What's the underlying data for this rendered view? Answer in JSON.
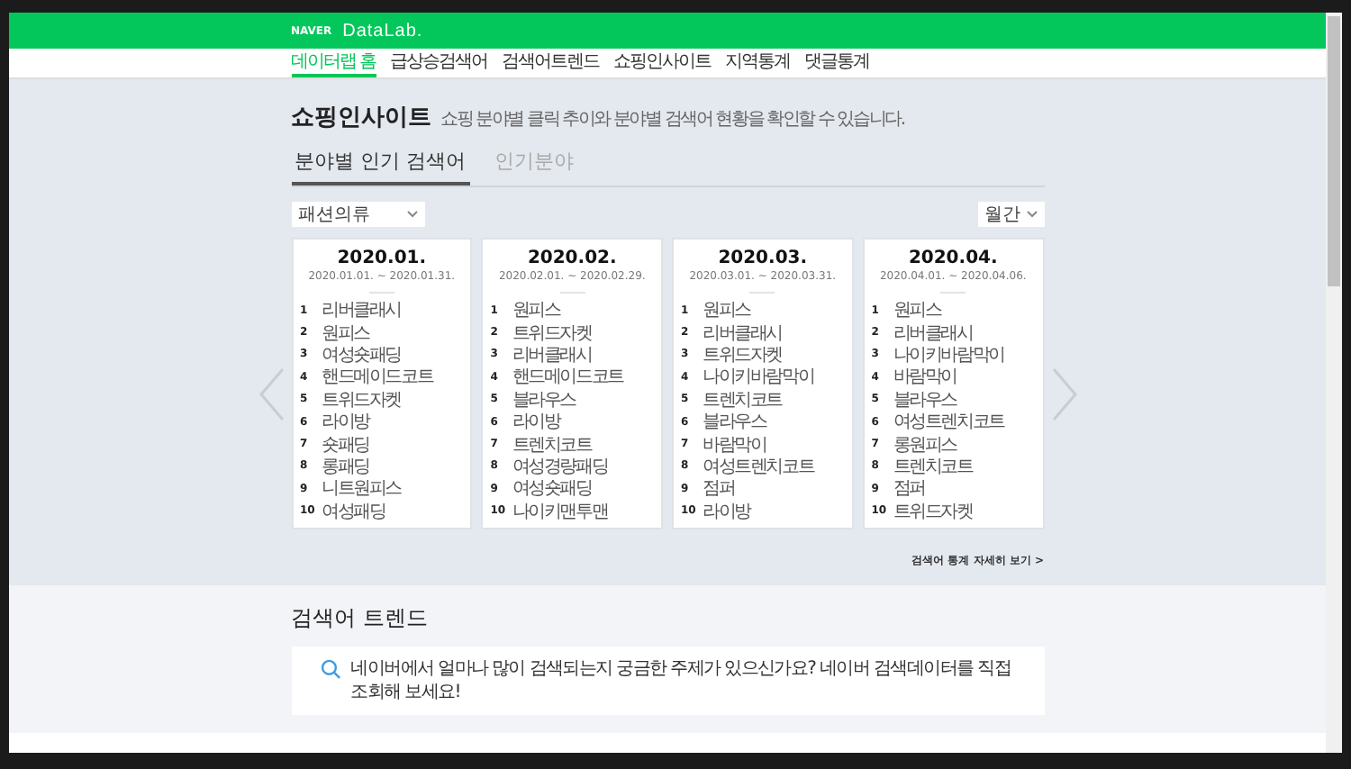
{
  "header": {
    "brand": "NAVER",
    "product": "DataLab."
  },
  "nav": [
    {
      "label": "데이터랩 홈",
      "selected": true
    },
    {
      "label": "급상승검색어",
      "selected": false
    },
    {
      "label": "검색어트렌드",
      "selected": false
    },
    {
      "label": "쇼핑인사이트",
      "selected": false
    },
    {
      "label": "지역통계",
      "selected": false
    },
    {
      "label": "댓글통계",
      "selected": false
    }
  ],
  "page": {
    "title": "쇼핑인사이트",
    "subtitle": "쇼핑 분야별 클릭 추이와 분야별 검색어 현황을 확인할 수 있습니다."
  },
  "tabs": [
    {
      "label": "분야별 인기 검색어",
      "selected": true
    },
    {
      "label": "인기분야",
      "selected": false
    }
  ],
  "category_select": {
    "value": "패션의류"
  },
  "period_select": {
    "value": "월간"
  },
  "cards": [
    {
      "month": "2020.01.",
      "range": "2020.01.01. ~ 2020.01.31.",
      "items": [
        {
          "rank": "1",
          "keyword": "리버클래시"
        },
        {
          "rank": "2",
          "keyword": "원피스"
        },
        {
          "rank": "3",
          "keyword": "여성숏패딩"
        },
        {
          "rank": "4",
          "keyword": "핸드메이드코트"
        },
        {
          "rank": "5",
          "keyword": "트위드자켓"
        },
        {
          "rank": "6",
          "keyword": "라이방"
        },
        {
          "rank": "7",
          "keyword": "숏패딩"
        },
        {
          "rank": "8",
          "keyword": "롱패딩"
        },
        {
          "rank": "9",
          "keyword": "니트원피스"
        },
        {
          "rank": "10",
          "keyword": "여성패딩"
        }
      ]
    },
    {
      "month": "2020.02.",
      "range": "2020.02.01. ~ 2020.02.29.",
      "items": [
        {
          "rank": "1",
          "keyword": "원피스"
        },
        {
          "rank": "2",
          "keyword": "트위드자켓"
        },
        {
          "rank": "3",
          "keyword": "리버클래시"
        },
        {
          "rank": "4",
          "keyword": "핸드메이드코트"
        },
        {
          "rank": "5",
          "keyword": "블라우스"
        },
        {
          "rank": "6",
          "keyword": "라이방"
        },
        {
          "rank": "7",
          "keyword": "트렌치코트"
        },
        {
          "rank": "8",
          "keyword": "여성경량패딩"
        },
        {
          "rank": "9",
          "keyword": "여성숏패딩"
        },
        {
          "rank": "10",
          "keyword": "나이키맨투맨"
        }
      ]
    },
    {
      "month": "2020.03.",
      "range": "2020.03.01. ~ 2020.03.31.",
      "items": [
        {
          "rank": "1",
          "keyword": "원피스"
        },
        {
          "rank": "2",
          "keyword": "리버클래시"
        },
        {
          "rank": "3",
          "keyword": "트위드자켓"
        },
        {
          "rank": "4",
          "keyword": "나이키바람막이"
        },
        {
          "rank": "5",
          "keyword": "트렌치코트"
        },
        {
          "rank": "6",
          "keyword": "블라우스"
        },
        {
          "rank": "7",
          "keyword": "바람막이"
        },
        {
          "rank": "8",
          "keyword": "여성트렌치코트"
        },
        {
          "rank": "9",
          "keyword": "점퍼"
        },
        {
          "rank": "10",
          "keyword": "라이방"
        }
      ]
    },
    {
      "month": "2020.04.",
      "range": "2020.04.01. ~ 2020.04.06.",
      "items": [
        {
          "rank": "1",
          "keyword": "원피스"
        },
        {
          "rank": "2",
          "keyword": "리버클래시"
        },
        {
          "rank": "3",
          "keyword": "나이키바람막이"
        },
        {
          "rank": "4",
          "keyword": "바람막이"
        },
        {
          "rank": "5",
          "keyword": "블라우스"
        },
        {
          "rank": "6",
          "keyword": "여성트렌치코트"
        },
        {
          "rank": "7",
          "keyword": "롱원피스"
        },
        {
          "rank": "8",
          "keyword": "트렌치코트"
        },
        {
          "rank": "9",
          "keyword": "점퍼"
        },
        {
          "rank": "10",
          "keyword": "트위드자켓"
        }
      ]
    }
  ],
  "more_link": "검색어 통계 자세히 보기 >",
  "trend": {
    "title": "검색어 트렌드",
    "prompt": "네이버에서 얼마나 많이 검색되는지 궁금한 주제가 있으신가요? 네이버 검색데이터를 직접 조회해 보세요!"
  }
}
